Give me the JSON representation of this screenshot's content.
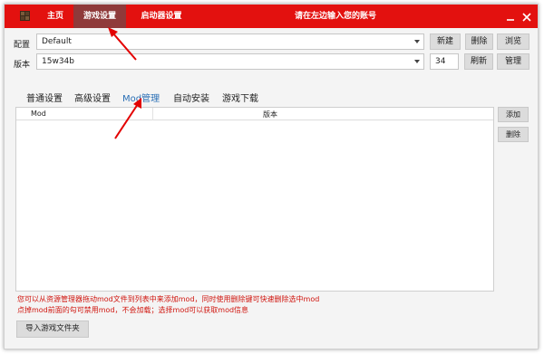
{
  "titlebar": {
    "nav": [
      "主页",
      "游戏设置",
      "启动器设置"
    ],
    "active_index": 1,
    "title": "请在左边输入您的账号"
  },
  "config": {
    "label": "配置",
    "value": "Default",
    "buttons": [
      "新建",
      "删除",
      "浏览"
    ]
  },
  "version": {
    "label": "版本",
    "value": "15w34b",
    "number": "34",
    "buttons": [
      "刷新",
      "管理"
    ]
  },
  "tabs": [
    "普通设置",
    "高级设置",
    "Mod管理",
    "自动安装",
    "游戏下载"
  ],
  "active_tab": 2,
  "mod_table": {
    "columns": [
      "Mod",
      "版本"
    ],
    "rows": []
  },
  "side_buttons": [
    "添加",
    "删除"
  ],
  "hint_lines": [
    "您可以从资源管理器拖动mod文件到列表中来添加mod，同时使用删除键可快速删除选中mod",
    "点掉mod前面的勾可禁用mod，不会加载；选择mod可以获取mod信息"
  ],
  "import_button": "导入游戏文件夹",
  "colors": {
    "titlebar": "#e3110f",
    "active_nav": "#8f3a3a",
    "active_tab": "#2a6fb5",
    "hint_text": "#d0160f",
    "annotation_arrow": "#e30000"
  }
}
